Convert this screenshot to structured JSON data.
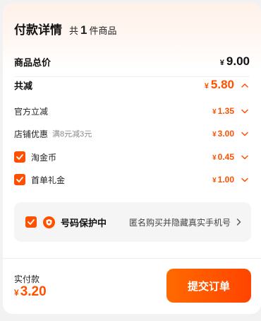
{
  "header": {
    "title": "付款详情",
    "count_prefix": "共",
    "count": "1",
    "count_suffix": "件商品"
  },
  "summary": {
    "total_label": "商品总价",
    "total_currency": "¥",
    "total_value": "9.00",
    "discount_label": "共减",
    "discount_currency": "¥",
    "discount_value": "5.80"
  },
  "discounts": [
    {
      "label": "官方立减",
      "hint": "",
      "currency": "¥",
      "value": "1.35",
      "checkbox": false
    },
    {
      "label": "店铺优惠",
      "hint": "满8元减3元",
      "currency": "¥",
      "value": "3.00",
      "checkbox": false
    },
    {
      "label": "淘金币",
      "hint": "",
      "currency": "¥",
      "value": "0.45",
      "checkbox": true,
      "checked": true
    },
    {
      "label": "首单礼金",
      "hint": "",
      "currency": "¥",
      "value": "1.00",
      "checkbox": true,
      "checked": true
    }
  ],
  "protection": {
    "checked": true,
    "title": "号码保护中",
    "description": "匿名购买并隐藏真实手机号",
    "icon": "shield-phone-icon"
  },
  "footer": {
    "pay_label": "实付款",
    "pay_currency": "¥",
    "pay_value": "3.20",
    "submit_label": "提交订单"
  },
  "colors": {
    "accent": "#ff5000",
    "panel_bg": "#f5f5f5"
  },
  "icons": {
    "chevron_up": "chevron-up-icon",
    "chevron_down": "chevron-down-icon",
    "chevron_right": "chevron-right-icon",
    "check": "check-icon"
  }
}
